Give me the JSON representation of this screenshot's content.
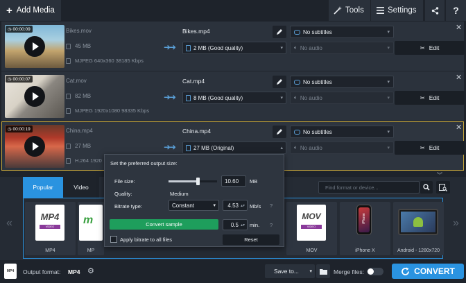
{
  "toolbar": {
    "add_media": "Add Media",
    "tools": "Tools",
    "settings": "Settings",
    "help": "?"
  },
  "files": [
    {
      "timecode": "00:00:09",
      "name": "Bikes.mov",
      "size": "45 MB",
      "info": "MJPEG 640x360 38185 Kbps",
      "output_name": "Bikes.mp4",
      "quality": "2 MB (Good quality)",
      "subtitles": "No subtitles",
      "audio": "No audio",
      "edit": "Edit"
    },
    {
      "timecode": "00:00:07",
      "name": "Cat.mov",
      "size": "82 MB",
      "info": "MJPEG 1920x1080 98335 Kbps",
      "output_name": "Cat.mp4",
      "quality": "8 MB (Good quality)",
      "subtitles": "No subtitles",
      "audio": "No audio",
      "edit": "Edit"
    },
    {
      "timecode": "00:00:19",
      "name": "China.mp4",
      "size": "27 MB",
      "info": "H.264 1920",
      "output_name": "China.mp4",
      "quality": "27 MB (Original)",
      "subtitles": "No subtitles",
      "audio": "No audio",
      "edit": "Edit"
    }
  ],
  "popup": {
    "title": "Set the preferred output size:",
    "file_size_label": "File size:",
    "file_size_value": "10.60",
    "file_size_unit": "MB",
    "file_size_slider_fraction": 0.6,
    "quality_label": "Quality:",
    "quality_value": "Medium",
    "bitrate_type_label": "Bitrate type:",
    "bitrate_type_value": "Constant",
    "bitrate_value": "4.53",
    "bitrate_unit": "Mb/s",
    "convert_sample": "Convert sample",
    "sample_value": "0.5",
    "sample_unit": "min.",
    "apply_all": "Apply bitrate to all files",
    "reset": "Reset"
  },
  "formats": {
    "tabs": [
      "Popular",
      "Video"
    ],
    "search_placeholder": "Find format or device...",
    "items": [
      {
        "label": "MP4",
        "badge": "MP4",
        "ribbon": "VIDEO"
      },
      {
        "label": "MP",
        "badge": ""
      },
      {
        "label": "MOV",
        "badge": "MOV",
        "ribbon": "VIDEO"
      },
      {
        "label": "iPhone X",
        "badge": "iPhone"
      },
      {
        "label": "Android - 1280x720",
        "badge": ""
      }
    ]
  },
  "bottom": {
    "output_format_label": "Output format:",
    "output_format_value": "MP4",
    "save_to": "Save to...",
    "merge_files": "Merge files:",
    "convert": "CONVERT"
  },
  "colors": {
    "accent": "#2a93e0",
    "selected_border": "#c9a83c",
    "convert_sample_bg": "#1e9e5c",
    "tab_active": "#2a93e0"
  }
}
